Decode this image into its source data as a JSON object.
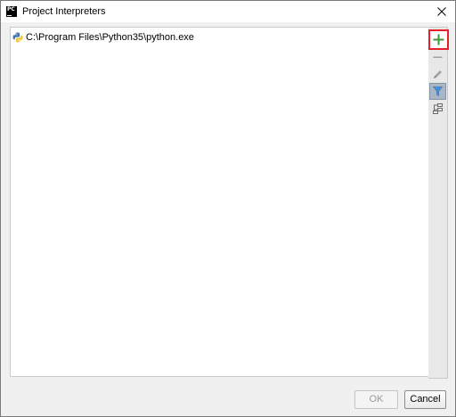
{
  "window": {
    "title": "Project Interpreters",
    "app_icon_text": "PC"
  },
  "interpreters": [
    {
      "path": "C:\\Program Files\\Python35\\python.exe",
      "icon": "python-icon"
    }
  ],
  "toolbar": {
    "buttons": [
      {
        "name": "add",
        "icon": "plus-icon",
        "highlighted": true,
        "highlight_color": "#e8202a"
      },
      {
        "name": "remove",
        "icon": "minus-icon",
        "enabled": false
      },
      {
        "name": "edit",
        "icon": "pencil-icon",
        "enabled": false
      },
      {
        "name": "filter",
        "icon": "filter-icon",
        "toggled": true
      },
      {
        "name": "show-paths",
        "icon": "tree-paths-icon"
      }
    ]
  },
  "footer": {
    "ok_label": "OK",
    "cancel_label": "Cancel"
  },
  "colors": {
    "accent_add": "#3c9a3c",
    "highlight_box": "#e8202a",
    "filter_toggle": "#4a8fd6"
  }
}
